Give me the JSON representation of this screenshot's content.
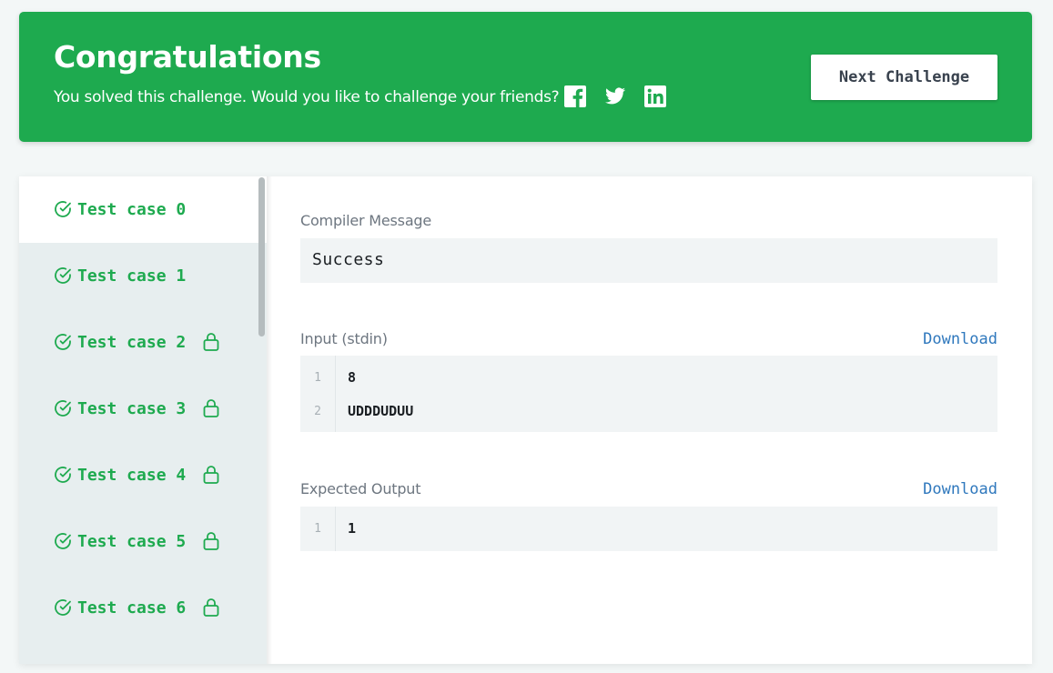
{
  "banner": {
    "title": "Congratulations",
    "subtitle": "You solved this challenge. Would you like to challenge your friends?",
    "social_icons": [
      "facebook-icon",
      "twitter-icon",
      "linkedin-icon"
    ],
    "next_button": "Next Challenge",
    "color": "#1eaa4f"
  },
  "test_cases": [
    {
      "label": "Test case 0",
      "locked": false,
      "active": true
    },
    {
      "label": "Test case 1",
      "locked": false,
      "active": false
    },
    {
      "label": "Test case 2",
      "locked": true,
      "active": false
    },
    {
      "label": "Test case 3",
      "locked": true,
      "active": false
    },
    {
      "label": "Test case 4",
      "locked": true,
      "active": false
    },
    {
      "label": "Test case 5",
      "locked": true,
      "active": false
    },
    {
      "label": "Test case 6",
      "locked": true,
      "active": false
    }
  ],
  "compiler": {
    "label": "Compiler Message",
    "message": "Success"
  },
  "input": {
    "label": "Input (stdin)",
    "download": "Download",
    "lines": [
      {
        "num": "1",
        "text": "8"
      },
      {
        "num": "2",
        "text": "UDDDUDUU"
      }
    ]
  },
  "expected": {
    "label": "Expected Output",
    "download": "Download",
    "lines": [
      {
        "num": "1",
        "text": "1"
      }
    ]
  },
  "colors": {
    "success_green": "#1eaa4f",
    "link_blue": "#2f78bd"
  }
}
